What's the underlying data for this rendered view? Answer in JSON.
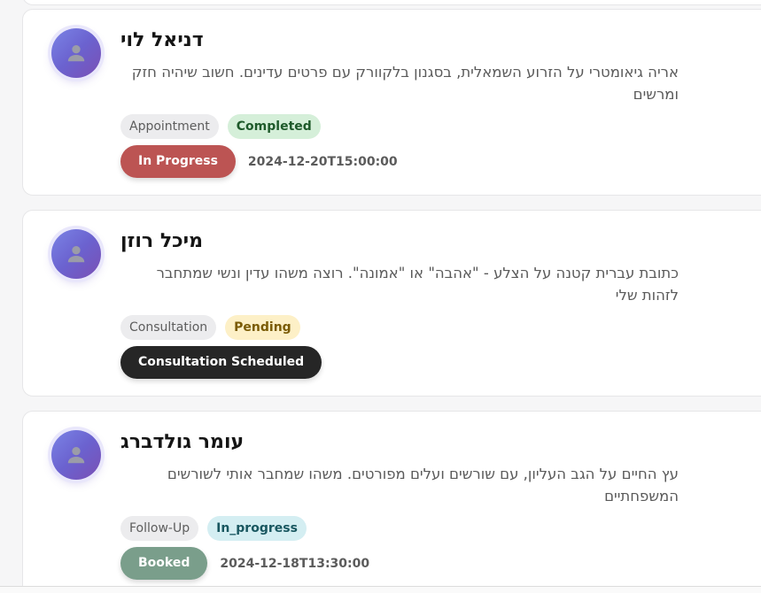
{
  "cards": [
    {
      "name": "דניאל לוי",
      "description": "אריה גיאומטרי על הזרוע השמאלית, בסגנון בלקוורק עם פרטים עדינים. חשוב שיהיה חזק ומרשים",
      "type_tag": "Appointment",
      "status_tag": "Completed",
      "action_label": "In Progress",
      "date": "2024-12-20T15:00:00"
    },
    {
      "name": "מיכל רוזן",
      "description": "כתובת עברית קטנה על הצלע - \"אהבה\" או \"אמונה\". רוצה משהו עדין ונשי שמתחבר לזהות שלי",
      "type_tag": "Consultation",
      "status_tag": "Pending",
      "action_label": "Consultation Scheduled",
      "date": ""
    },
    {
      "name": "עומר גולדברג",
      "description": "עץ החיים על הגב העליון, עם שורשים ועלים מפורטים. משהו שמחבר אותי לשורשים המשפחתיים",
      "type_tag": "Follow-Up",
      "status_tag": "In_progress",
      "action_label": "Booked",
      "date": "2024-12-18T13:30:00"
    }
  ],
  "colors": {
    "avatar_gradient_start": "#7b84e6",
    "avatar_gradient_end": "#7a4fb4",
    "in_progress_button": "#bc5453",
    "scheduled_button": "#262626",
    "booked_button": "#7a9e8b",
    "completed_tag_bg": "#d5efd9",
    "pending_tag_bg": "#fdf0c7",
    "in_progress_tag_bg": "#d4eef2"
  },
  "icons": {
    "avatar": "user-silhouette-icon"
  }
}
